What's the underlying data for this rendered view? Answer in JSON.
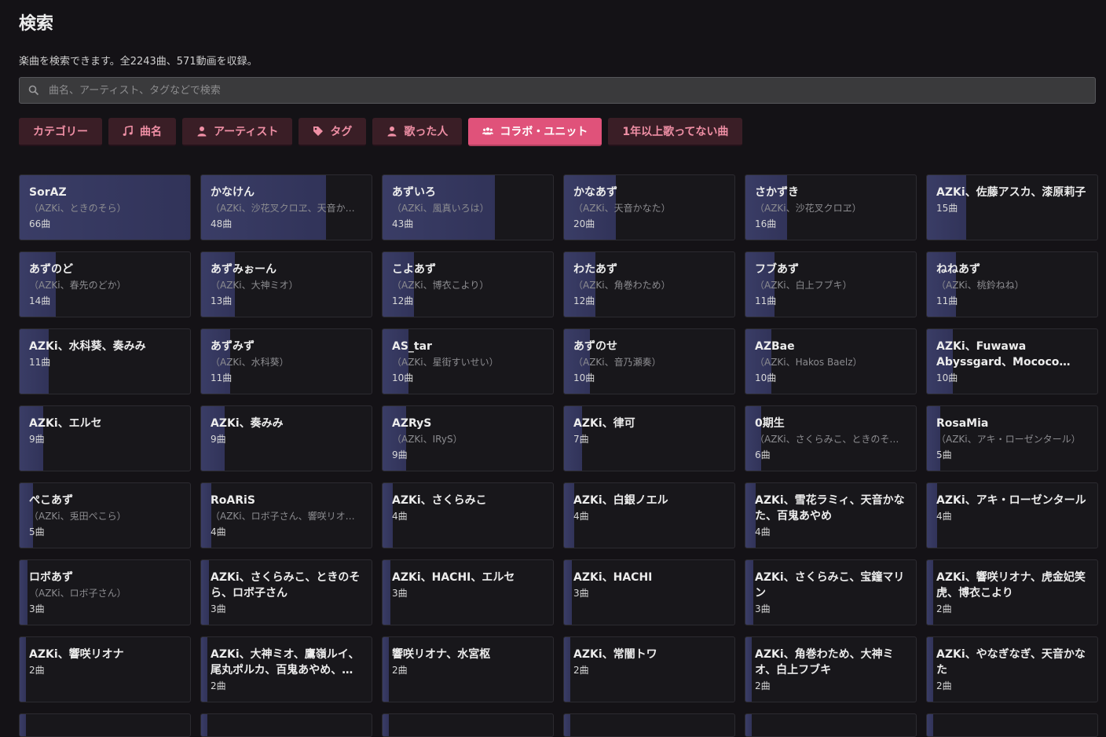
{
  "page": {
    "title": "検索",
    "description": "楽曲を検索できます。全2243曲、571動画を収録。"
  },
  "search": {
    "placeholder": "曲名、アーティスト、タグなどで検索",
    "icon": "search-icon"
  },
  "tabs": [
    {
      "label": "カテゴリー",
      "icon": "",
      "active": false
    },
    {
      "label": "曲名",
      "icon": "music-note-icon",
      "active": false
    },
    {
      "label": "アーティスト",
      "icon": "person-icon",
      "active": false
    },
    {
      "label": "タグ",
      "icon": "tag-icon",
      "active": false
    },
    {
      "label": "歌った人",
      "icon": "person-icon",
      "active": false
    },
    {
      "label": "コラボ・ユニット",
      "icon": "users-icon",
      "active": true
    },
    {
      "label": "1年以上歌ってない曲",
      "icon": "",
      "active": false
    }
  ],
  "colors": {
    "background": "#141216",
    "accent": "#e0527a",
    "tab_bg": "#3a1e26",
    "tab_text": "#ef8fa5",
    "bar": "#3a3d66"
  },
  "max_count": 66,
  "units": [
    {
      "name": "SorAZ",
      "members": "（AZKi、ときのそら）",
      "count": "66曲",
      "value": 66
    },
    {
      "name": "かなけん",
      "members": "（AZKi、沙花叉クロヱ、天音かなた）",
      "count": "48曲",
      "value": 48
    },
    {
      "name": "あずいろ",
      "members": "（AZKi、風真いろは）",
      "count": "43曲",
      "value": 43
    },
    {
      "name": "かなあず",
      "members": "（AZKi、天音かなた）",
      "count": "20曲",
      "value": 20
    },
    {
      "name": "さかずき",
      "members": "（AZKi、沙花叉クロヱ）",
      "count": "16曲",
      "value": 16
    },
    {
      "name": "AZKi、佐藤アスカ、漆原莉子",
      "members": "",
      "count": "15曲",
      "value": 15
    },
    {
      "name": "あずのど",
      "members": "（AZKi、春先のどか）",
      "count": "14曲",
      "value": 14
    },
    {
      "name": "あずみぉーん",
      "members": "（AZKi、大神ミオ）",
      "count": "13曲",
      "value": 13
    },
    {
      "name": "こよあず",
      "members": "（AZKi、博衣こより）",
      "count": "12曲",
      "value": 12
    },
    {
      "name": "わたあず",
      "members": "（AZKi、角巻わため）",
      "count": "12曲",
      "value": 12
    },
    {
      "name": "フブあず",
      "members": "（AZKi、白上フブキ）",
      "count": "11曲",
      "value": 11
    },
    {
      "name": "ねねあず",
      "members": "（AZKi、桃鈴ねね）",
      "count": "11曲",
      "value": 11
    },
    {
      "name": "AZKi、水科葵、奏みみ",
      "members": "",
      "count": "11曲",
      "value": 11
    },
    {
      "name": "あずみず",
      "members": "（AZKi、水科葵）",
      "count": "11曲",
      "value": 11
    },
    {
      "name": "AS_tar",
      "members": "（AZKi、星街すいせい）",
      "count": "10曲",
      "value": 10
    },
    {
      "name": "あずのせ",
      "members": "（AZKi、音乃瀬奏）",
      "count": "10曲",
      "value": 10
    },
    {
      "name": "AZBae",
      "members": "（AZKi、Hakos Baelz）",
      "count": "10曲",
      "value": 10
    },
    {
      "name": "AZKi、Fuwawa Abyssgard、Mococo Abyssgard、湊あくあ",
      "members": "",
      "count": "10曲",
      "value": 10
    },
    {
      "name": "AZKi、エルセ",
      "members": "",
      "count": "9曲",
      "value": 9
    },
    {
      "name": "AZKi、奏みみ",
      "members": "",
      "count": "9曲",
      "value": 9
    },
    {
      "name": "AZRyS",
      "members": "（AZKi、IRyS）",
      "count": "9曲",
      "value": 9
    },
    {
      "name": "AZKi、律可",
      "members": "",
      "count": "7曲",
      "value": 7
    },
    {
      "name": "0期生",
      "members": "（AZKi、さくらみこ、ときのそら、星街すいせい、ロボ子さん）",
      "count": "6曲",
      "value": 6
    },
    {
      "name": "RosaMia",
      "members": "（AZKi、アキ・ローゼンタール）",
      "count": "5曲",
      "value": 5
    },
    {
      "name": "ぺこあず",
      "members": "（AZKi、兎田ぺこら）",
      "count": "5曲",
      "value": 5
    },
    {
      "name": "RoARiS",
      "members": "（AZKi、ロボ子さん、響咲リオナ）",
      "count": "4曲",
      "value": 4
    },
    {
      "name": "AZKi、さくらみこ",
      "members": "",
      "count": "4曲",
      "value": 4
    },
    {
      "name": "AZKi、白銀ノエル",
      "members": "",
      "count": "4曲",
      "value": 4
    },
    {
      "name": "AZKi、雪花ラミィ、天音かなた、百鬼あやめ",
      "members": "",
      "count": "4曲",
      "value": 4
    },
    {
      "name": "AZKi、アキ・ローゼンタール",
      "members": "",
      "count": "4曲",
      "value": 4
    },
    {
      "name": "ロボあず",
      "members": "（AZKi、ロボ子さん）",
      "count": "3曲",
      "value": 3
    },
    {
      "name": "AZKi、さくらみこ、ときのそら、ロボ子さん",
      "members": "",
      "count": "3曲",
      "value": 3
    },
    {
      "name": "AZKi、HACHI、エルセ",
      "members": "",
      "count": "3曲",
      "value": 3
    },
    {
      "name": "AZKi、HACHI",
      "members": "",
      "count": "3曲",
      "value": 3
    },
    {
      "name": "AZKi、さくらみこ、宝鐘マリン",
      "members": "",
      "count": "3曲",
      "value": 3
    },
    {
      "name": "AZKi、響咲リオナ、虎金妃笑虎、博衣こより",
      "members": "",
      "count": "2曲",
      "value": 2
    },
    {
      "name": "AZKi、響咲リオナ",
      "members": "",
      "count": "2曲",
      "value": 2
    },
    {
      "name": "AZKi、大神ミオ、鷹嶺ルイ、尾丸ポルカ、百鬼あやめ、…",
      "members": "",
      "count": "2曲",
      "value": 2
    },
    {
      "name": "響咲リオナ、水宮枢",
      "members": "",
      "count": "2曲",
      "value": 2
    },
    {
      "name": "AZKi、常闇トワ",
      "members": "",
      "count": "2曲",
      "value": 2
    },
    {
      "name": "AZKi、角巻わため、大神ミオ、白上フブキ",
      "members": "",
      "count": "2曲",
      "value": 2
    },
    {
      "name": "AZKi、やなぎなぎ、天音かなた",
      "members": "",
      "count": "2曲",
      "value": 2
    }
  ],
  "partial_row_bars": [
    2,
    2,
    2,
    2,
    2,
    2
  ]
}
